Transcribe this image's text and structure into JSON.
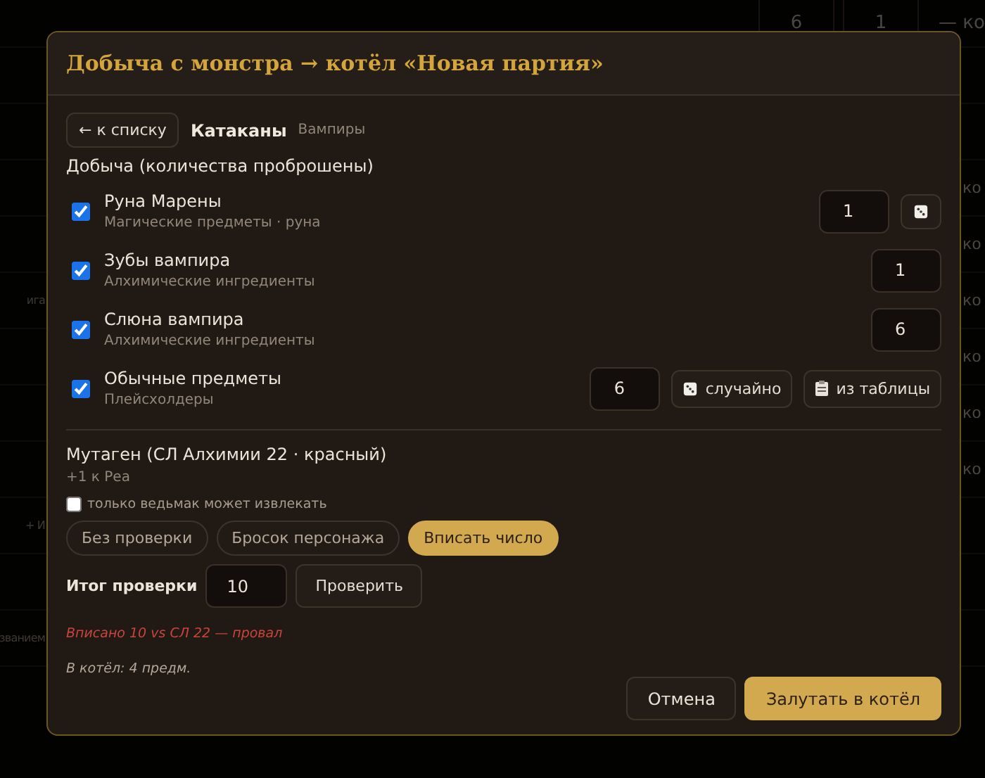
{
  "background": {
    "top_cells": [
      "6",
      "1",
      "— ко"
    ],
    "rows": [
      {
        "left": "",
        "right": ""
      },
      {
        "left": "",
        "right": ""
      },
      {
        "left": "",
        "right": "ко"
      },
      {
        "left": "",
        "right": "ко"
      },
      {
        "left": "ига",
        "right": "ко"
      },
      {
        "left": "",
        "right": "ко"
      },
      {
        "left": "",
        "right": "ко"
      },
      {
        "left": "",
        "right": "ко"
      },
      {
        "left": "+ И",
        "right": ""
      },
      {
        "left": "",
        "right": ""
      },
      {
        "left": "званием",
        "right": ""
      }
    ]
  },
  "dialog": {
    "title": "Добыча с монстра → котёл «Новая партия»"
  },
  "back_button": "← к списку",
  "monster": {
    "name": "Катаканы",
    "category": "Вампиры"
  },
  "loot": {
    "heading": "Добыча (количества проброшены)",
    "items": [
      {
        "kind": "roll",
        "checked": true,
        "name": "Руна Марены",
        "subtitle": "Магические предметы · руна",
        "quantity": "1"
      },
      {
        "kind": "plain",
        "checked": true,
        "name": "Зубы вампира",
        "subtitle": "Алхимические ингредиенты",
        "quantity": "1"
      },
      {
        "kind": "plain",
        "checked": true,
        "name": "Слюна вампира",
        "subtitle": "Алхимические ингредиенты",
        "quantity": "6"
      },
      {
        "kind": "table",
        "checked": true,
        "name": "Обычные предметы",
        "subtitle": "Плейсхолдеры",
        "quantity": "6",
        "random_button": "случайно",
        "table_button": "из таблицы"
      }
    ]
  },
  "mutagen": {
    "title": "Мутаген (СЛ Алхимии 22 · красный)",
    "effect": "+1 к Реа",
    "witcher_only": {
      "label": "только ведьмак может извлекать",
      "checked": false
    },
    "check_modes": [
      {
        "label": "Без проверки",
        "selected": false
      },
      {
        "label": "Бросок персонажа",
        "selected": false
      },
      {
        "label": "Вписать число",
        "selected": true
      }
    ],
    "result_label": "Итог проверки",
    "result_value": "10",
    "check_button": "Проверить",
    "outcome": {
      "text": "Вписано 10 vs СЛ 22 — провал",
      "failed": true
    }
  },
  "summary": "В котёл: 4 предм.",
  "buttons": [
    {
      "label": "Отмена",
      "kind": "secondary"
    },
    {
      "label": "Залутать в котёл",
      "kind": "primary"
    }
  ]
}
